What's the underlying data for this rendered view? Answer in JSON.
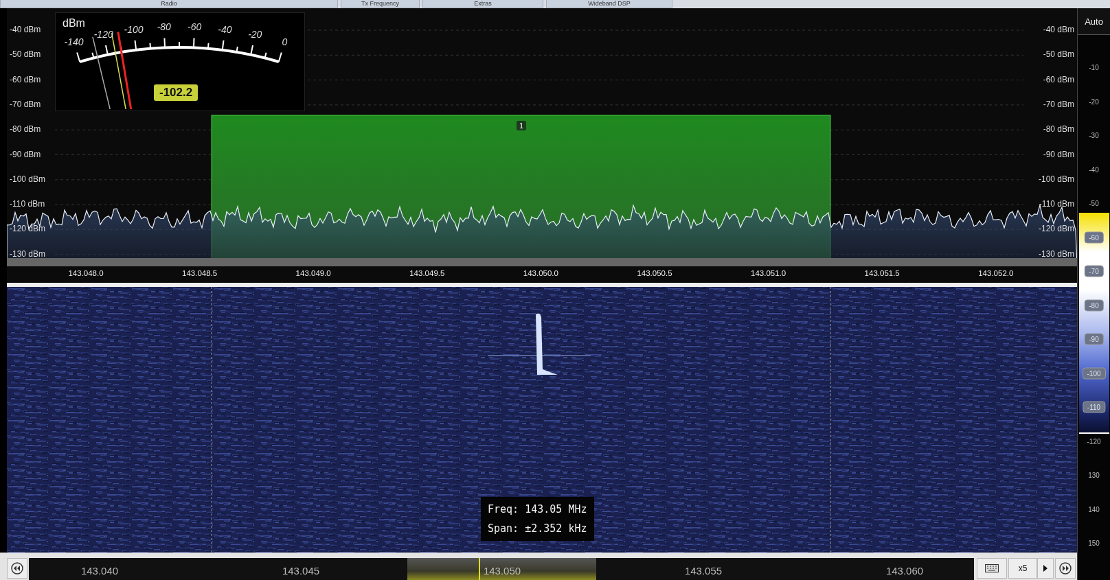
{
  "tabs": [
    {
      "label": "Radio",
      "selected": false
    },
    {
      "label": "Tx Frequency",
      "selected": false
    },
    {
      "label": "Extras",
      "selected": false
    },
    {
      "label": "Wideband DSP",
      "selected": false
    }
  ],
  "spectrum": {
    "left_scale": [
      "-40 dBm",
      "-50 dBm",
      "-60 dBm",
      "-70 dBm",
      "-80 dBm",
      "-90 dBm",
      "-100 dBm",
      "-110 dBm",
      "-120 dBm",
      "-130 dBm"
    ],
    "right_scale": [
      "-40 dBm",
      "-50 dBm",
      "-60 dBm",
      "-70 dBm",
      "-80 dBm",
      "-90 dBm",
      "-100 dBm",
      "-110 dBm",
      "-120 dBm",
      "-130 dBm"
    ],
    "freq_axis": [
      "143.048.0",
      "143.048.5",
      "143.049.0",
      "143.049.5",
      "143.050.0",
      "143.050.5",
      "143.051.0",
      "143.051.5",
      "143.052.0"
    ],
    "filter": {
      "label": "1"
    }
  },
  "meter": {
    "unit": "dBm",
    "scale": [
      "-140",
      "-120",
      "-100",
      "-80",
      "-60",
      "-40",
      "-20",
      "0"
    ],
    "reading": "-102.2"
  },
  "waterfall": {
    "tooltip": [
      "Freq: 143.05 MHz",
      "Span: ±2.352 kHz"
    ]
  },
  "waterfall_scale": {
    "mode": "Auto",
    "labels": [
      {
        "text": "-10",
        "boxed": false
      },
      {
        "text": "-20",
        "boxed": false
      },
      {
        "text": "-30",
        "boxed": false
      },
      {
        "text": "-40",
        "boxed": false
      },
      {
        "text": "-50",
        "boxed": false
      },
      {
        "text": "-60",
        "boxed": true
      },
      {
        "text": "-70",
        "boxed": true
      },
      {
        "text": "-80",
        "boxed": true
      },
      {
        "text": "-90",
        "boxed": true
      },
      {
        "text": "-100",
        "boxed": true
      },
      {
        "text": "-110",
        "boxed": true
      },
      {
        "text": "-120",
        "boxed": false
      },
      {
        "text": "130",
        "boxed": false
      },
      {
        "text": "140",
        "boxed": false
      },
      {
        "text": "150",
        "boxed": false
      }
    ]
  },
  "bottom_bar": {
    "freq_labels": [
      "143.040",
      "143.045",
      "143.050",
      "143.055",
      "143.060"
    ],
    "zoom": "x5"
  }
}
